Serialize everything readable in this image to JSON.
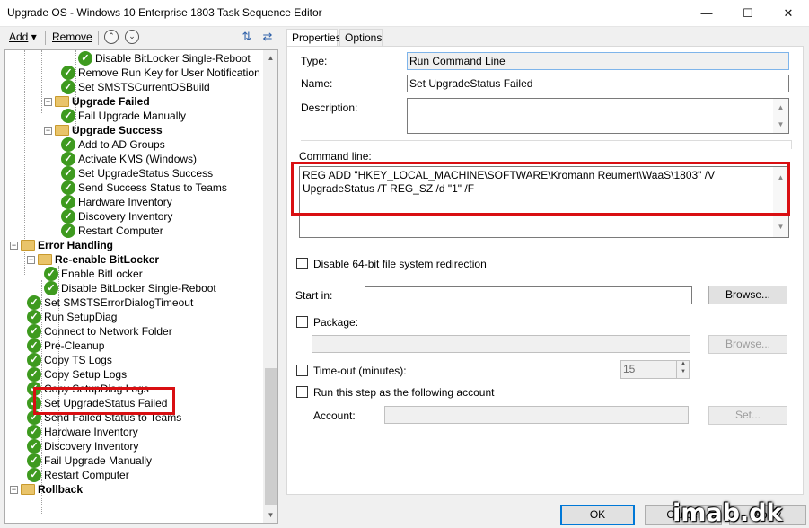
{
  "window": {
    "title": "Upgrade OS - Windows 10 Enterprise 1803 Task Sequence Editor",
    "minimize": "—",
    "maximize": "☐",
    "close": "✕"
  },
  "toolbar": {
    "add_label": "Add",
    "add_arrow": "▾",
    "remove_label": "Remove",
    "move_up": "⌃",
    "move_down": "⌄",
    "icon_a": "⇅",
    "icon_b": "⇄"
  },
  "tree": {
    "items": [
      {
        "label": "Disable BitLocker Single-Reboot",
        "kind": "step"
      },
      {
        "label": "Remove Run Key for User Notification",
        "kind": "step"
      },
      {
        "label": "Set SMSTSCurrentOSBuild",
        "kind": "step"
      },
      {
        "label": "Upgrade Failed",
        "kind": "group"
      },
      {
        "label": "Fail Upgrade Manually",
        "kind": "step"
      },
      {
        "label": "Upgrade Success",
        "kind": "group"
      },
      {
        "label": "Add to AD Groups",
        "kind": "step"
      },
      {
        "label": "Activate KMS (Windows)",
        "kind": "step"
      },
      {
        "label": "Set UpgradeStatus Success",
        "kind": "step"
      },
      {
        "label": "Send Success Status to Teams",
        "kind": "step"
      },
      {
        "label": "Hardware Inventory",
        "kind": "step"
      },
      {
        "label": "Discovery Inventory",
        "kind": "step"
      },
      {
        "label": "Restart Computer",
        "kind": "step"
      },
      {
        "label": "Error Handling",
        "kind": "group"
      },
      {
        "label": "Re-enable BitLocker",
        "kind": "group"
      },
      {
        "label": "Enable BitLocker",
        "kind": "step"
      },
      {
        "label": "Disable BitLocker Single-Reboot",
        "kind": "step"
      },
      {
        "label": "Set SMSTSErrorDialogTimeout",
        "kind": "step"
      },
      {
        "label": "Run SetupDiag",
        "kind": "step"
      },
      {
        "label": "Connect to Network Folder",
        "kind": "step"
      },
      {
        "label": "Pre-Cleanup",
        "kind": "step"
      },
      {
        "label": "Copy TS Logs",
        "kind": "step"
      },
      {
        "label": "Copy Setup Logs",
        "kind": "step"
      },
      {
        "label": "Copy SetupDiag Logs",
        "kind": "step"
      },
      {
        "label": "Set UpgradeStatus Failed",
        "kind": "step"
      },
      {
        "label": "Send Failed Status to Teams",
        "kind": "step"
      },
      {
        "label": "Hardware Inventory",
        "kind": "step"
      },
      {
        "label": "Discovery Inventory",
        "kind": "step"
      },
      {
        "label": "Fail Upgrade Manually",
        "kind": "step"
      },
      {
        "label": "Restart Computer",
        "kind": "step"
      },
      {
        "label": "Rollback",
        "kind": "group"
      }
    ],
    "collapse_glyph": "−",
    "check_glyph": "✓",
    "scroll_up": "▲",
    "scroll_down": "▼"
  },
  "tabs": [
    {
      "label": "Properties"
    },
    {
      "label": "Options"
    }
  ],
  "properties": {
    "type_label": "Type:",
    "type_value": "Run Command Line",
    "name_label": "Name:",
    "name_value": "Set UpgradeStatus Failed",
    "description_label": "Description:",
    "description_value": "",
    "command_line_label": "Command line:",
    "command_line_value": "REG ADD \"HKEY_LOCAL_MACHINE\\SOFTWARE\\Kromann Reumert\\WaaS\\1803\" /V UpgradeStatus /T REG_SZ /d \"1\" /F",
    "disable_64bit_label": "Disable 64-bit file system redirection",
    "start_in_label": "Start in:",
    "start_in_value": "",
    "browse_label": "Browse...",
    "package_label": "Package:",
    "package_value": "",
    "package_browse_label": "Browse...",
    "timeout_label": "Time-out (minutes):",
    "timeout_value": "15",
    "run_as_label": "Run this step as the following account",
    "account_label": "Account:",
    "account_value": "",
    "set_label": "Set...",
    "scroll_up": "▲",
    "scroll_down": "▼"
  },
  "buttons": {
    "ok": "OK",
    "cancel": "Cancel",
    "apply": "Apply"
  },
  "watermark": "imab.dk"
}
